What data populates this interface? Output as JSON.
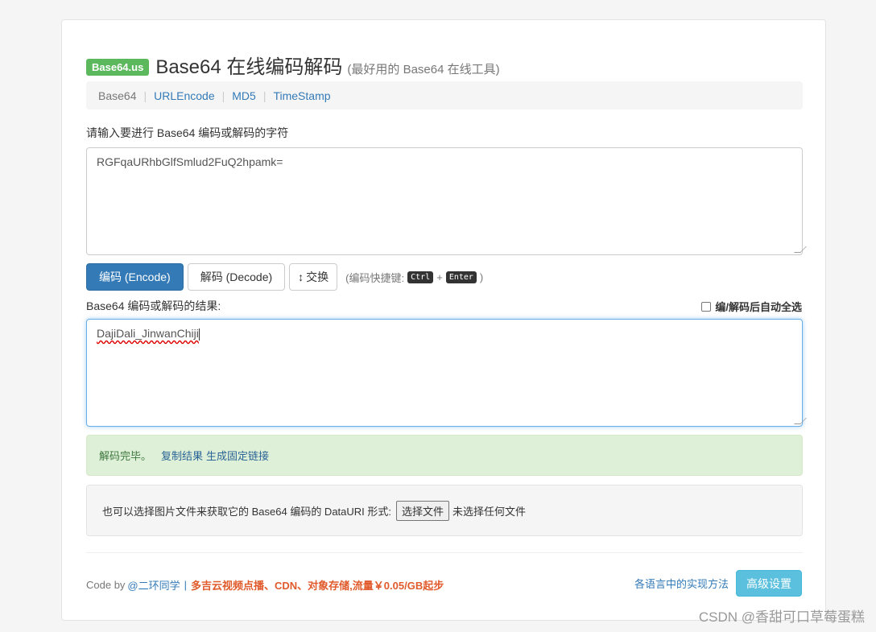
{
  "header": {
    "logo_text": "Base64.us",
    "title": "Base64 在线编码解码",
    "subtitle": "(最好用的 Base64 在线工具)"
  },
  "nav": {
    "items": [
      "Base64",
      "URLEncode",
      "MD5",
      "TimeStamp"
    ],
    "separator": "|"
  },
  "input": {
    "label": "请输入要进行 Base64 编码或解码的字符",
    "value": "RGFqaURhbGlfSmlud2FuQ2hpamk="
  },
  "buttons": {
    "encode": "编码 (Encode)",
    "decode": "解码 (Decode)",
    "swap_icon": "↕",
    "swap": "交换"
  },
  "hint": {
    "prefix": "(编码快捷键:",
    "key1": "Ctrl",
    "plus": "+",
    "key2": "Enter",
    "suffix": ")"
  },
  "output": {
    "label": "Base64 编码或解码的结果:",
    "value": "DajiDali_JinwanChiji",
    "auto_select_label": "编/解码后自动全选",
    "auto_select_checked": false
  },
  "alert": {
    "message": "解码完毕。",
    "copy_link": "复制结果",
    "permalink": "生成固定链接"
  },
  "file": {
    "prompt": "也可以选择图片文件来获取它的 Base64 编码的 DataURI 形式:",
    "button": "选择文件",
    "status": "未选择任何文件"
  },
  "footer": {
    "code_by": "Code by",
    "author": "@二环同学",
    "pipe": "|",
    "promo": "多吉云视频点播、CDN、对象存储,流量￥0.05/GB起步",
    "impl_link": "各语言中的实现方法",
    "advanced": "高级设置"
  },
  "watermark": "CSDN @香甜可口草莓蛋糕",
  "colors": {
    "primary": "#337ab7",
    "success_badge": "#5cb85c",
    "alert_bg": "#dff0d8",
    "info": "#5bc0de",
    "promo": "#e05a2b"
  }
}
